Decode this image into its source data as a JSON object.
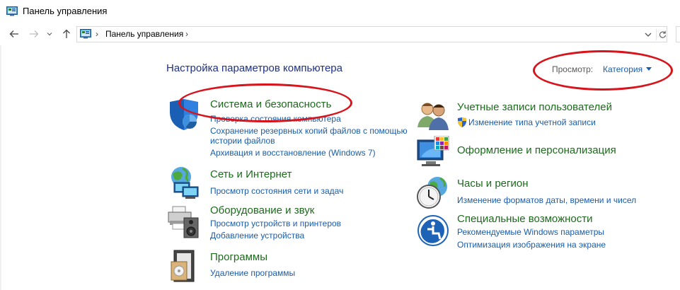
{
  "window": {
    "title": "Панель управления"
  },
  "address": {
    "crumb": "Панель управления"
  },
  "main": {
    "heading": "Настройка параметров компьютера",
    "view_label": "Просмотр:",
    "view_value": "Категория"
  },
  "left_categories": [
    {
      "title": "Система и безопасность",
      "icon": "shield-icon",
      "links": [
        "Проверка состояния компьютера",
        "Сохранение резервных копий файлов с помощью",
        "истории файлов",
        "Архивация и восстановление (Windows 7)"
      ]
    },
    {
      "title": "Сеть и Интернет",
      "icon": "network-globe-icon",
      "links": [
        "Просмотр состояния сети и задач"
      ]
    },
    {
      "title": "Оборудование и звук",
      "icon": "printer-speaker-icon",
      "links": [
        "Просмотр устройств и принтеров",
        "Добавление устройства"
      ]
    },
    {
      "title": "Программы",
      "icon": "programs-box-icon",
      "links": [
        "Удаление программы"
      ]
    }
  ],
  "right_categories": [
    {
      "title": "Учетные записи пользователей",
      "icon": "users-icon",
      "links": [
        "Изменение типа учетной записи"
      ]
    },
    {
      "title": "Оформление и персонализация",
      "icon": "monitor-palette-icon",
      "links": []
    },
    {
      "title": "Часы и регион",
      "icon": "clock-globe-icon",
      "links": [
        "Изменение форматов даты, времени и чисел"
      ]
    },
    {
      "title": "Специальные возможности",
      "icon": "accessibility-icon",
      "links": [
        "Рекомендуемые Windows параметры",
        "Оптимизация изображения на экране"
      ]
    }
  ],
  "colors": {
    "category_title": "#1c6b1c",
    "link": "#1a5ca8",
    "heading": "#1e3287",
    "annotation": "#d7141b"
  }
}
